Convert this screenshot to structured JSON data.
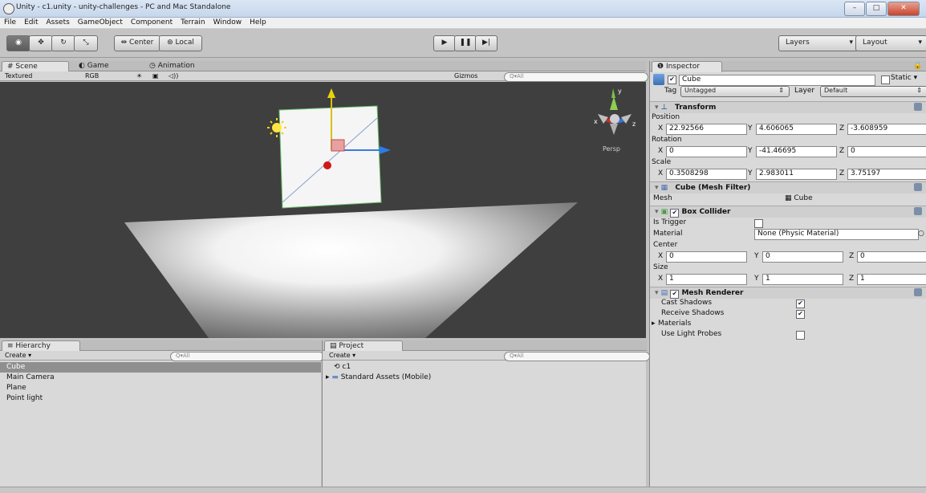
{
  "window": {
    "title": "Unity - c1.unity - unity-challenges - PC and Mac Standalone"
  },
  "menu": [
    "File",
    "Edit",
    "Assets",
    "GameObject",
    "Component",
    "Terrain",
    "Window",
    "Help"
  ],
  "toolbar": {
    "pivot_center": "Center",
    "pivot_local": "Local",
    "layers": "Layers",
    "layout": "Layout"
  },
  "scene": {
    "tabs": [
      "Scene",
      "Game",
      "Animation"
    ],
    "render_mode": "Textured",
    "color_mode": "RGB",
    "gizmos": "Gizmos",
    "search_placeholder": "Q▾All",
    "persp_label": "Persp",
    "axis_y": "y",
    "axis_x": "x",
    "axis_z": "z"
  },
  "hierarchy": {
    "title": "Hierarchy",
    "create": "Create",
    "search_placeholder": "Q▾All",
    "items": [
      "Cube",
      "Main Camera",
      "Plane",
      "Point light"
    ]
  },
  "project": {
    "title": "Project",
    "create": "Create",
    "search_placeholder": "Q▾All",
    "items": [
      "c1",
      "Standard Assets (Mobile)"
    ]
  },
  "inspector": {
    "title": "Inspector",
    "object_name": "Cube",
    "static_label": "Static",
    "tag_label": "Tag",
    "tag_value": "Untagged",
    "layer_label": "Layer",
    "layer_value": "Default",
    "transform": {
      "title": "Transform",
      "position_label": "Position",
      "position": {
        "x": "22.92566",
        "y": "4.606065",
        "z": "-3.608959"
      },
      "rotation_label": "Rotation",
      "rotation": {
        "x": "0",
        "y": "-41.46695",
        "z": "0"
      },
      "scale_label": "Scale",
      "scale": {
        "x": "0.3508298",
        "y": "2.983011",
        "z": "3.75197"
      }
    },
    "mesh_filter": {
      "title": "Cube (Mesh Filter)",
      "mesh_label": "Mesh",
      "mesh_value": "Cube"
    },
    "box_collider": {
      "title": "Box Collider",
      "is_trigger_label": "Is Trigger",
      "material_label": "Material",
      "material_value": "None (Physic Material)",
      "center_label": "Center",
      "center": {
        "x": "0",
        "y": "0",
        "z": "0"
      },
      "size_label": "Size",
      "size": {
        "x": "1",
        "y": "1",
        "z": "1"
      }
    },
    "mesh_renderer": {
      "title": "Mesh Renderer",
      "cast_shadows": "Cast Shadows",
      "receive_shadows": "Receive Shadows",
      "materials": "Materials",
      "use_light_probes": "Use Light Probes"
    }
  },
  "colors": {
    "scene_bg": "#3f3f3f",
    "selection": "#8f8f8f",
    "title_bar": "#c5d6ec"
  }
}
